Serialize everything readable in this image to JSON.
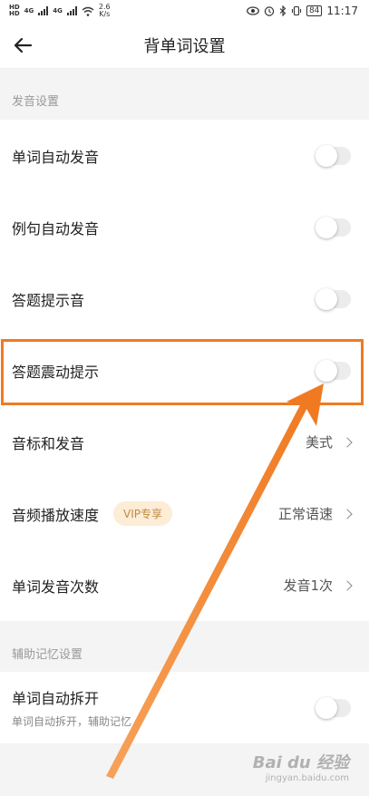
{
  "status_bar": {
    "hd1": "HD",
    "hd2": "HD",
    "net1": "4G",
    "net2": "4G",
    "speed_value": "2.6",
    "speed_unit": "K/s",
    "battery": "84",
    "time": "11:17"
  },
  "header": {
    "title": "背单词设置"
  },
  "sections": [
    {
      "title": "发音设置"
    },
    {
      "title": "辅助记忆设置"
    }
  ],
  "rows": {
    "word_auto_pronounce": {
      "label": "单词自动发音",
      "toggle_on": false
    },
    "sentence_auto_pronounce": {
      "label": "例句自动发音",
      "toggle_on": false
    },
    "answer_sound": {
      "label": "答题提示音",
      "toggle_on": false
    },
    "answer_vibrate": {
      "label": "答题震动提示",
      "toggle_on": false
    },
    "phonetic": {
      "label": "音标和发音",
      "value": "美式"
    },
    "audio_speed": {
      "label": "音频播放速度",
      "badge": "VIP专享",
      "value": "正常语速"
    },
    "pronounce_count": {
      "label": "单词发音次数",
      "value": "发音1次"
    },
    "word_split": {
      "label": "单词自动拆开",
      "sub_label": "单词自动拆开，辅助记忆",
      "toggle_on": false
    }
  },
  "watermark": {
    "logo": "Bai du 经验",
    "url": "jingyan.baidu.com"
  },
  "colors": {
    "highlight": "#f07a22",
    "vip_bg": "#fdecd6",
    "vip_text": "#c08a45"
  }
}
